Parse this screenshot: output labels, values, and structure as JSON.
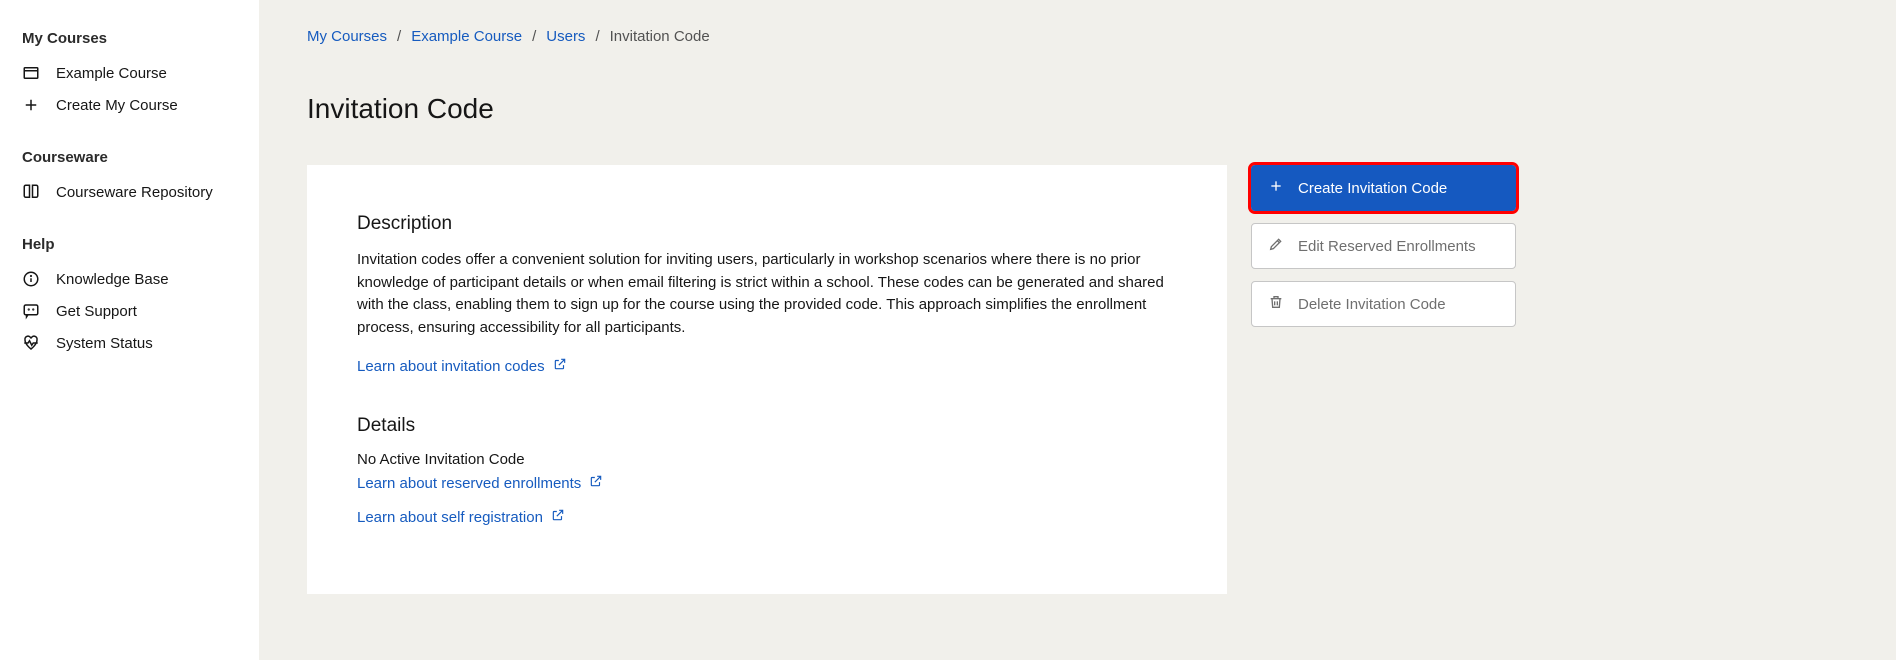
{
  "sidebar": {
    "sections": [
      {
        "heading": "My Courses",
        "items": [
          {
            "icon": "course",
            "label": "Example Course"
          },
          {
            "icon": "plus",
            "label": "Create My Course"
          }
        ]
      },
      {
        "heading": "Courseware",
        "items": [
          {
            "icon": "book",
            "label": "Courseware Repository"
          }
        ]
      },
      {
        "heading": "Help",
        "items": [
          {
            "icon": "info",
            "label": "Knowledge Base"
          },
          {
            "icon": "chat",
            "label": "Get Support"
          },
          {
            "icon": "heart",
            "label": "System Status"
          }
        ]
      }
    ]
  },
  "breadcrumb": {
    "items": [
      {
        "label": "My Courses",
        "link": true
      },
      {
        "label": "Example Course",
        "link": true
      },
      {
        "label": "Users",
        "link": true
      },
      {
        "label": "Invitation Code",
        "link": false
      }
    ]
  },
  "page": {
    "title": "Invitation Code"
  },
  "panel": {
    "description_heading": "Description",
    "description_text": "Invitation codes offer a convenient solution for inviting users, particularly in workshop scenarios where there is no prior knowledge of participant details or when email filtering is strict within a school. These codes can be generated and shared with the class, enabling them to sign up for the course using the provided code. This approach simplifies the enrollment process, ensuring accessibility for all participants.",
    "learn_invitation": "Learn about invitation codes",
    "details_heading": "Details",
    "details_status": "No Active Invitation Code",
    "learn_reserved": "Learn about reserved enrollments",
    "learn_self": "Learn about self registration"
  },
  "actions": {
    "create": "Create Invitation Code",
    "edit": "Edit Reserved Enrollments",
    "delete": "Delete Invitation Code"
  }
}
